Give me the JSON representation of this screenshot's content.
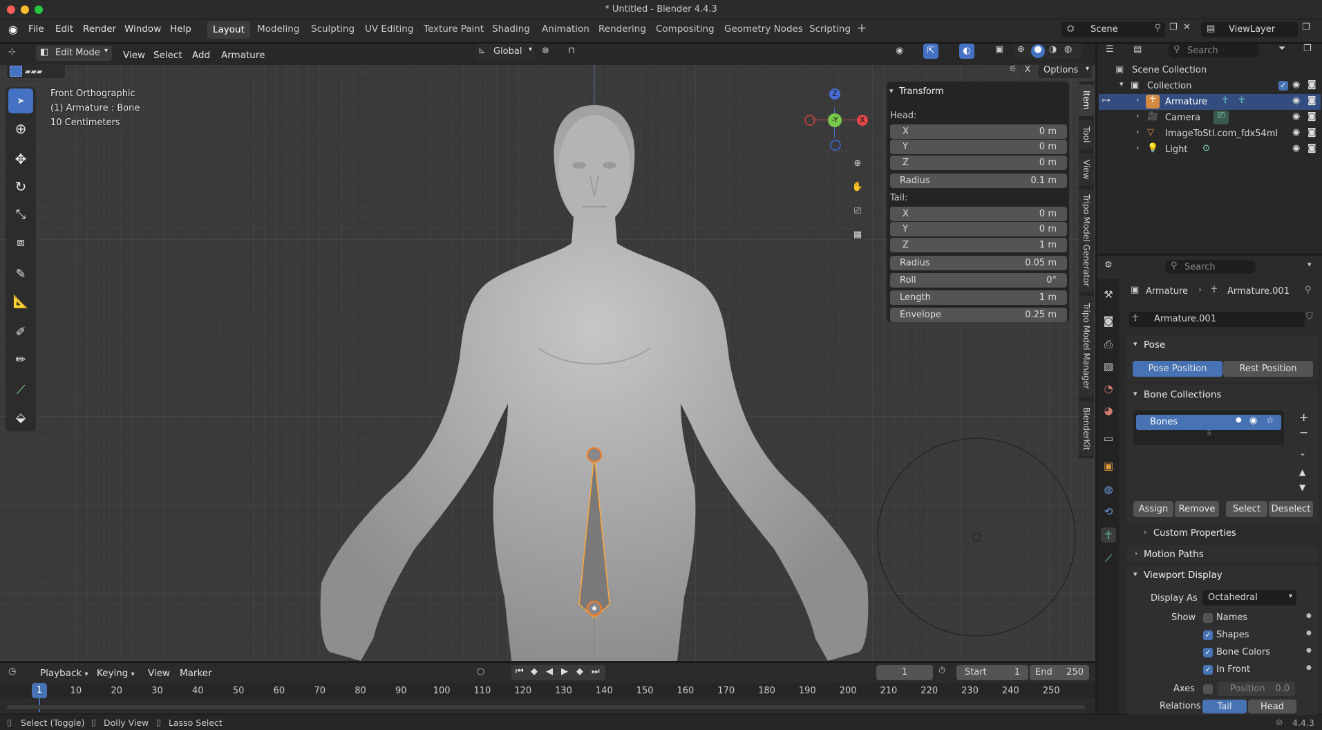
{
  "window": {
    "title": "* Untitled - Blender 4.4.3"
  },
  "menubar": {
    "items": [
      "File",
      "Edit",
      "Render",
      "Window",
      "Help"
    ]
  },
  "workspaces": [
    "Layout",
    "Modeling",
    "Sculpting",
    "UV Editing",
    "Texture Paint",
    "Shading",
    "Animation",
    "Rendering",
    "Compositing",
    "Geometry Nodes",
    "Scripting"
  ],
  "active_workspace": "Layout",
  "scene": {
    "scene_name": "Scene",
    "view_layer": "ViewLayer"
  },
  "viewport_header": {
    "mode": "Edit Mode",
    "menus": [
      "View",
      "Select",
      "Add",
      "Armature"
    ],
    "orientation": "Global",
    "options": "Options"
  },
  "viewport_overlay": {
    "view": "Front Orthographic",
    "object": "(1) Armature : Bone",
    "scale": "10 Centimeters"
  },
  "gizmo": {
    "z": "Z",
    "y": "Y",
    "x": "X"
  },
  "n_panel": {
    "title": "Transform",
    "head_label": "Head:",
    "head": [
      {
        "label": "X",
        "value": "0 m"
      },
      {
        "label": "Y",
        "value": "0 m"
      },
      {
        "label": "Z",
        "value": "0 m"
      }
    ],
    "head_radius": {
      "label": "Radius",
      "value": "0.1 m"
    },
    "tail_label": "Tail:",
    "tail": [
      {
        "label": "X",
        "value": "0 m"
      },
      {
        "label": "Y",
        "value": "0 m"
      },
      {
        "label": "Z",
        "value": "1 m"
      }
    ],
    "tail_radius": {
      "label": "Radius",
      "value": "0.05 m"
    },
    "roll": {
      "label": "Roll",
      "value": "0°"
    },
    "length": {
      "label": "Length",
      "value": "1 m"
    },
    "envelope": {
      "label": "Envelope",
      "value": "0.25 m"
    },
    "tabs": [
      "Item",
      "Tool",
      "View",
      "Tripo Model Generator",
      "Tripo Model Manager",
      "BlenderKit"
    ]
  },
  "outliner": {
    "search_placeholder": "Search",
    "root": "Scene Collection",
    "collection": "Collection",
    "items": [
      "Armature",
      "Camera",
      "ImageToStl.com_fdx54ml",
      "Light"
    ]
  },
  "properties": {
    "search_placeholder": "Search",
    "breadcrumb": [
      "Armature",
      "Armature.001"
    ],
    "data_name": "Armature.001",
    "pose": {
      "title": "Pose",
      "pose_position": "Pose Position",
      "rest_position": "Rest Position"
    },
    "bone_collections": {
      "title": "Bone Collections",
      "items": [
        "Bones"
      ],
      "assign": "Assign",
      "remove": "Remove",
      "select": "Select",
      "deselect": "Deselect"
    },
    "custom_properties": "Custom Properties",
    "motion_paths": "Motion Paths",
    "viewport_display": {
      "title": "Viewport Display",
      "display_as_label": "Display As",
      "display_as": "Octahedral",
      "show_label": "Show",
      "names": "Names",
      "shapes": "Shapes",
      "bone_colors": "Bone Colors",
      "in_front": "In Front",
      "axes_label": "Axes",
      "position_label": "Position",
      "position_value": "0.0",
      "relations_label": "Relations",
      "tail": "Tail",
      "head": "Head"
    }
  },
  "timeline": {
    "menus": [
      "Playback",
      "Keying",
      "View",
      "Marker"
    ],
    "current_frame": "1",
    "start_label": "Start",
    "start": "1",
    "end_label": "End",
    "end": "250",
    "ticks": [
      "1",
      "10",
      "20",
      "30",
      "40",
      "50",
      "60",
      "70",
      "80",
      "90",
      "100",
      "110",
      "120",
      "130",
      "140",
      "150",
      "160",
      "170",
      "180",
      "190",
      "200",
      "210",
      "220",
      "230",
      "240",
      "250"
    ]
  },
  "statusbar": {
    "hints": [
      "Select (Toggle)",
      "Dolly View",
      "Lasso Select"
    ],
    "version": "4.4.3"
  }
}
